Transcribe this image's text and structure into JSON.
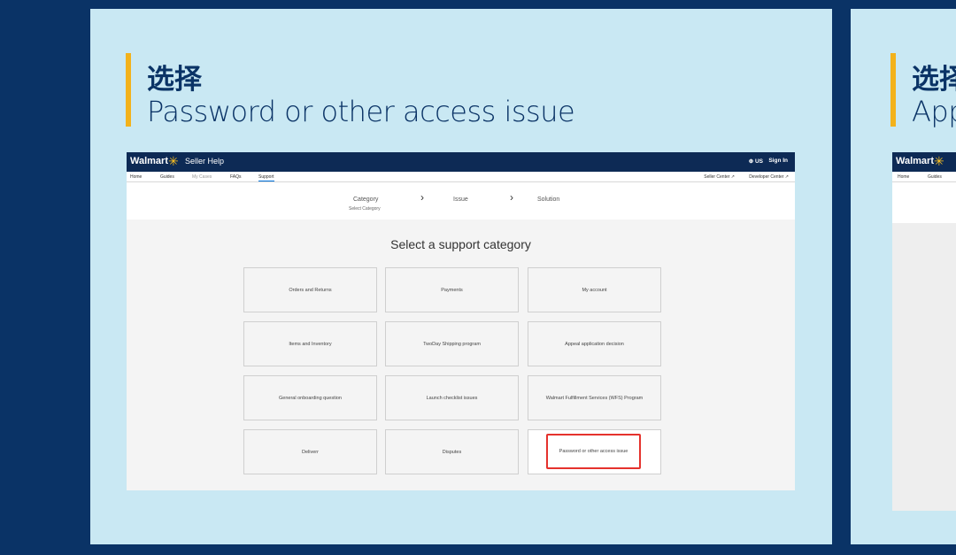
{
  "slides": [
    {
      "title": "选择",
      "subtitle": "Password or other access issue"
    },
    {
      "title": "选择",
      "subtitle": "App"
    }
  ],
  "colors": {
    "page_bg": "#0a3366",
    "card_bg": "#c9e8f3",
    "accent": "#f3b21b",
    "walmart_blue": "#0d2a55",
    "spark_yellow": "#ffc220",
    "highlight_red": "#e5322d"
  },
  "walmart": {
    "logo": "Walmart",
    "app_name": "Seller Help",
    "lang": "⊕ US",
    "sign_in": "Sign In",
    "nav": [
      "Home",
      "Guides",
      "My Cases",
      "FAQs",
      "Support"
    ],
    "nav_right": [
      "Seller Center ↗",
      "Developer Center ↗"
    ],
    "steps": [
      {
        "label": "Category",
        "sub": "Select Category"
      },
      {
        "label": "Issue"
      },
      {
        "label": "Solution"
      }
    ],
    "select_title": "Select a support category",
    "tiles": [
      "Orders and Returns",
      "Payments",
      "My account",
      "Items and Inventory",
      "TwoDay Shipping program",
      "Appeal application decision",
      "General onboarding question",
      "Launch checklist issues",
      "Walmart Fulfillment Services (WFS) Program",
      "Deliverr",
      "Disputes",
      "Password or other access issue"
    ],
    "highlighted_tile_index": 11
  }
}
